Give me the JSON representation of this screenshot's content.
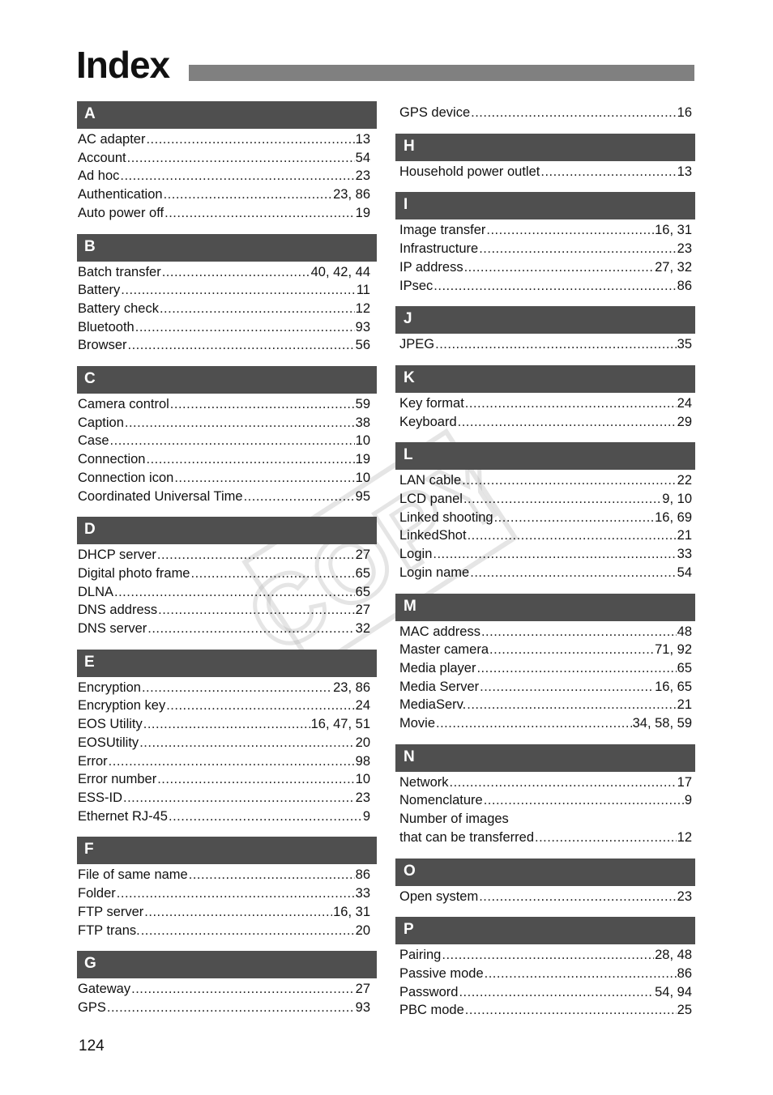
{
  "header": {
    "title": "Index"
  },
  "page_number": "124",
  "watermark": {
    "text": "COPY"
  },
  "left_column": [
    {
      "letter": "A",
      "entries": [
        {
          "term": "AC adapter",
          "pages": "13"
        },
        {
          "term": "Account",
          "pages": "54"
        },
        {
          "term": "Ad hoc",
          "pages": "23"
        },
        {
          "term": "Authentication",
          "pages": "23, 86"
        },
        {
          "term": "Auto power off",
          "pages": "19"
        }
      ]
    },
    {
      "letter": "B",
      "entries": [
        {
          "term": "Batch transfer",
          "pages": "40, 42, 44"
        },
        {
          "term": "Battery",
          "pages": "11"
        },
        {
          "term": "Battery check",
          "pages": "12"
        },
        {
          "term": "Bluetooth",
          "pages": "93"
        },
        {
          "term": "Browser",
          "pages": "56"
        }
      ]
    },
    {
      "letter": "C",
      "entries": [
        {
          "term": "Camera control",
          "pages": "59"
        },
        {
          "term": "Caption",
          "pages": "38"
        },
        {
          "term": "Case",
          "pages": "10"
        },
        {
          "term": "Connection",
          "pages": "19"
        },
        {
          "term": "Connection icon",
          "pages": "10"
        },
        {
          "term": "Coordinated Universal Time",
          "pages": "95"
        }
      ]
    },
    {
      "letter": "D",
      "entries": [
        {
          "term": "DHCP server",
          "pages": "27"
        },
        {
          "term": "Digital photo frame",
          "pages": "65"
        },
        {
          "term": "DLNA",
          "pages": "65"
        },
        {
          "term": "DNS address",
          "pages": "27"
        },
        {
          "term": "DNS server",
          "pages": "32"
        }
      ]
    },
    {
      "letter": "E",
      "entries": [
        {
          "term": "Encryption",
          "pages": "23, 86"
        },
        {
          "term": "Encryption key",
          "pages": "24"
        },
        {
          "term": "EOS Utility",
          "pages": "16, 47, 51"
        },
        {
          "term": "EOSUtility",
          "pages": "20"
        },
        {
          "term": "Error",
          "pages": "98"
        },
        {
          "term": "Error number",
          "pages": "10"
        },
        {
          "term": "ESS-ID",
          "pages": "23"
        },
        {
          "term": "Ethernet RJ-45",
          "pages": "9"
        }
      ]
    },
    {
      "letter": "F",
      "entries": [
        {
          "term": "File of same name",
          "pages": "86"
        },
        {
          "term": "Folder",
          "pages": "33"
        },
        {
          "term": "FTP server",
          "pages": "16, 31"
        },
        {
          "term": "FTP trans.",
          "pages": "20"
        }
      ]
    },
    {
      "letter": "G",
      "entries": [
        {
          "term": "Gateway",
          "pages": "27"
        },
        {
          "term": "GPS",
          "pages": "93"
        }
      ]
    }
  ],
  "right_column": {
    "continued_entry": {
      "term": "GPS device",
      "pages": "16"
    },
    "sections": [
      {
        "letter": "H",
        "entries": [
          {
            "term": "Household power outlet",
            "pages": "13"
          }
        ]
      },
      {
        "letter": "I",
        "entries": [
          {
            "term": "Image transfer",
            "pages": "16, 31"
          },
          {
            "term": "Infrastructure",
            "pages": "23"
          },
          {
            "term": "IP address",
            "pages": "27, 32"
          },
          {
            "term": "IPsec",
            "pages": "86"
          }
        ]
      },
      {
        "letter": "J",
        "entries": [
          {
            "term": "JPEG",
            "pages": "35"
          }
        ]
      },
      {
        "letter": "K",
        "entries": [
          {
            "term": "Key format",
            "pages": "24"
          },
          {
            "term": "Keyboard",
            "pages": "29"
          }
        ]
      },
      {
        "letter": "L",
        "entries": [
          {
            "term": "LAN cable",
            "pages": "22"
          },
          {
            "term": "LCD panel",
            "pages": "9, 10"
          },
          {
            "term": "Linked shooting",
            "pages": "16, 69"
          },
          {
            "term": "LinkedShot",
            "pages": "21"
          },
          {
            "term": "Login",
            "pages": "33"
          },
          {
            "term": "Login name",
            "pages": "54"
          }
        ]
      },
      {
        "letter": "M",
        "entries": [
          {
            "term": "MAC address",
            "pages": "48"
          },
          {
            "term": "Master camera",
            "pages": "71, 92"
          },
          {
            "term": "Media player",
            "pages": "65"
          },
          {
            "term": "Media Server",
            "pages": "16, 65"
          },
          {
            "term": "MediaServ.",
            "pages": "21"
          },
          {
            "term": "Movie",
            "pages": "34, 58, 59"
          }
        ]
      },
      {
        "letter": "N",
        "entries": [
          {
            "term": "Network",
            "pages": "17"
          },
          {
            "term": "Nomenclature",
            "pages": "9"
          },
          {
            "term": "Number of images",
            "pages": ""
          },
          {
            "term": "that can be transferred",
            "pages": "12"
          }
        ]
      },
      {
        "letter": "O",
        "entries": [
          {
            "term": "Open system",
            "pages": "23"
          }
        ]
      },
      {
        "letter": "P",
        "entries": [
          {
            "term": "Pairing",
            "pages": "28, 48"
          },
          {
            "term": "Passive mode",
            "pages": "86"
          },
          {
            "term": "Password",
            "pages": "54, 94"
          },
          {
            "term": "PBC mode",
            "pages": "25"
          }
        ]
      }
    ]
  },
  "colors": {
    "section_header_bg": "#4f4f4f",
    "title_bar": "#808080",
    "text": "#111111"
  }
}
